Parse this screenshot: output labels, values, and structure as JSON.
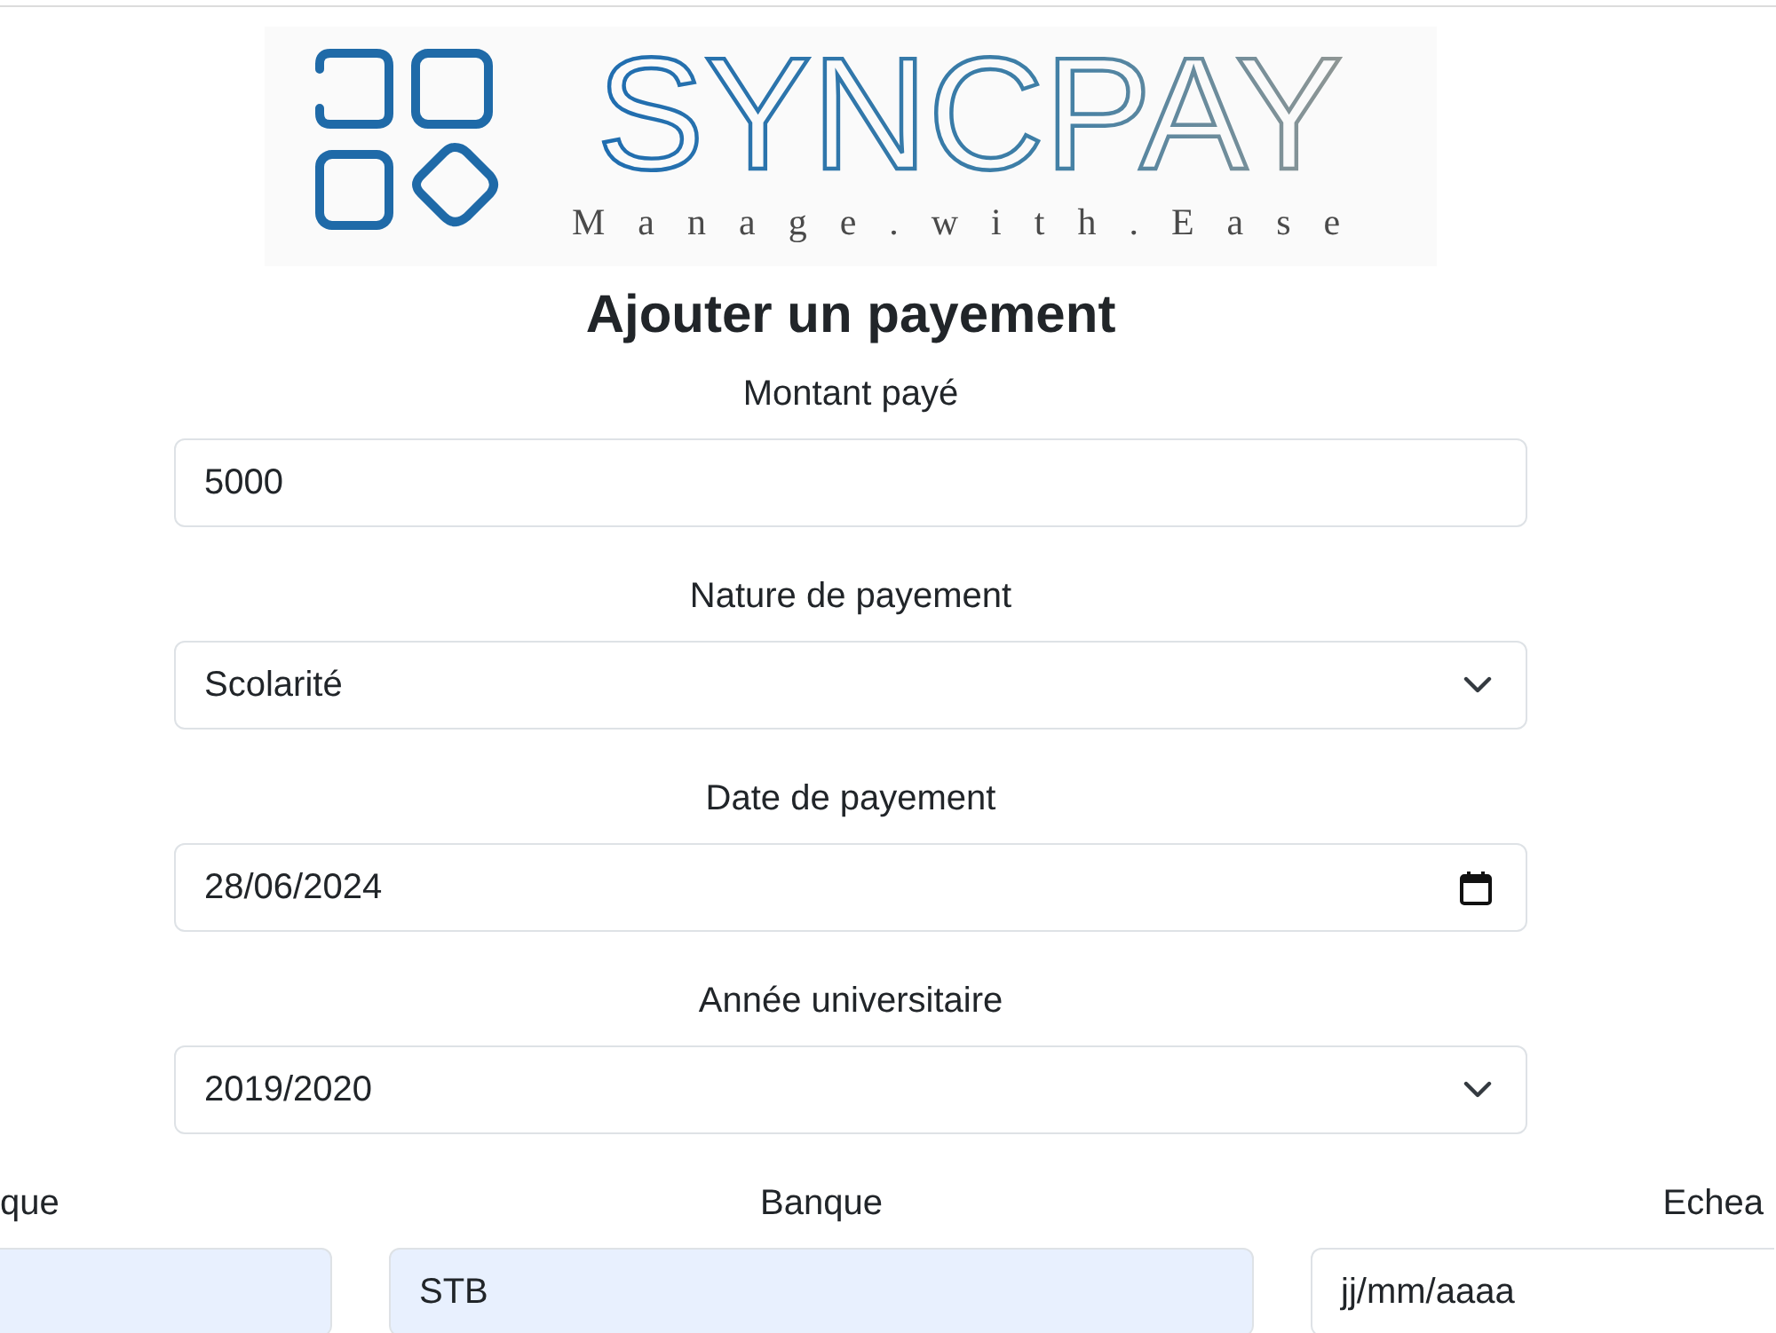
{
  "logo": {
    "name": "SYNCPAY",
    "tagline": "Manage.with.Ease"
  },
  "title": "Ajouter un payement",
  "fields": [
    {
      "label": "Montant payé",
      "kind": "text",
      "value": "5000"
    },
    {
      "label": "Nature de payement",
      "kind": "select",
      "value": "Scolarité"
    },
    {
      "label": "Date de payement",
      "kind": "date",
      "value": "28/06/2024"
    },
    {
      "label": "Année universitaire",
      "kind": "select",
      "value": "2019/2020"
    }
  ],
  "bottom_fields": [
    {
      "label": "que",
      "autofilled": true
    },
    {
      "label": "Banque",
      "value": "STB",
      "autofilled": true
    },
    {
      "label": "Echea",
      "placeholder": "jj/mm/aaaa",
      "autofilled": false
    }
  ]
}
